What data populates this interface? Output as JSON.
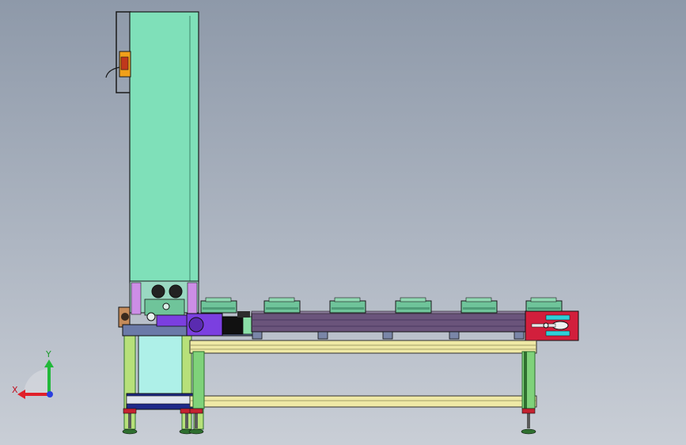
{
  "viewport": {
    "background_top": "#8e99a9",
    "background_bottom": "#c9ced6"
  },
  "colors": {
    "tower": "#7fe0b9",
    "lower_panel": "#aef0e8",
    "frame_green": "#b7e07a",
    "frame_dark": "#2f6f2f",
    "rail_yellow": "#efe9a6",
    "conveyor_purple": "#6a547b",
    "drive_purple": "#7b3fe0",
    "motor_black": "#111111",
    "end_panel_red": "#d21f3c",
    "carrier_green": "#6fc49a",
    "outline": "#1a1a1a"
  },
  "carriers": [
    {
      "label": "carrier-1"
    },
    {
      "label": "carrier-2"
    },
    {
      "label": "carrier-3"
    },
    {
      "label": "carrier-4"
    },
    {
      "label": "carrier-5"
    },
    {
      "label": "carrier-6"
    }
  ],
  "axis_triad": {
    "x_label": "X",
    "y_label": "Y",
    "x_color": "#e0202a",
    "y_color": "#22b83a",
    "z_color": "#2a3fe0"
  }
}
